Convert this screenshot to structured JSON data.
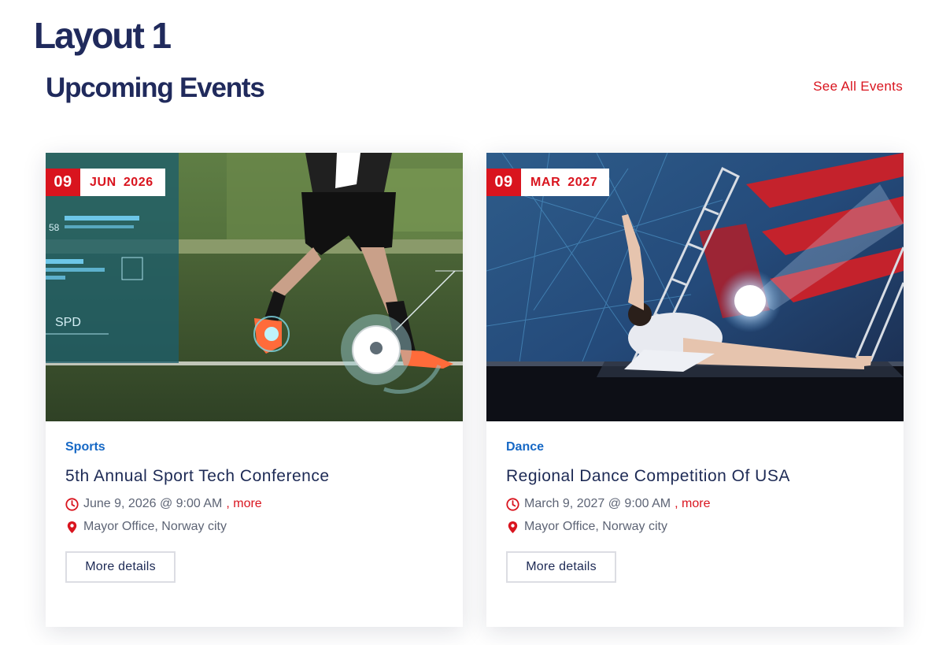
{
  "page": {
    "layout_title": "Layout 1",
    "section_title": "Upcoming Events",
    "see_all_label": "See All Events"
  },
  "colors": {
    "accent": "#d9141e",
    "category": "#1668c5",
    "heading": "#202a5c"
  },
  "events": [
    {
      "day": "09",
      "month": "JUN",
      "year": "2026",
      "category": "Sports",
      "title": "5th Annual Sport Tech Conference",
      "datetime": "June 9, 2026 @ 9:00 AM",
      "more_label": ", more",
      "location": "Mayor Office, Norway city",
      "button_label": "More details",
      "image": "soccer-player-with-tech-hud-photo"
    },
    {
      "day": "09",
      "month": "MAR",
      "year": "2027",
      "category": "Dance",
      "title": "Regional Dance Competition Of USA",
      "datetime": "March 9, 2027 @ 9:00 AM",
      "more_label": ", more",
      "location": "Mayor Office, Norway city",
      "button_label": "More details",
      "image": "dancer-on-stage-photo"
    }
  ],
  "icons": {
    "clock": "clock-icon",
    "pin": "map-pin-icon"
  }
}
